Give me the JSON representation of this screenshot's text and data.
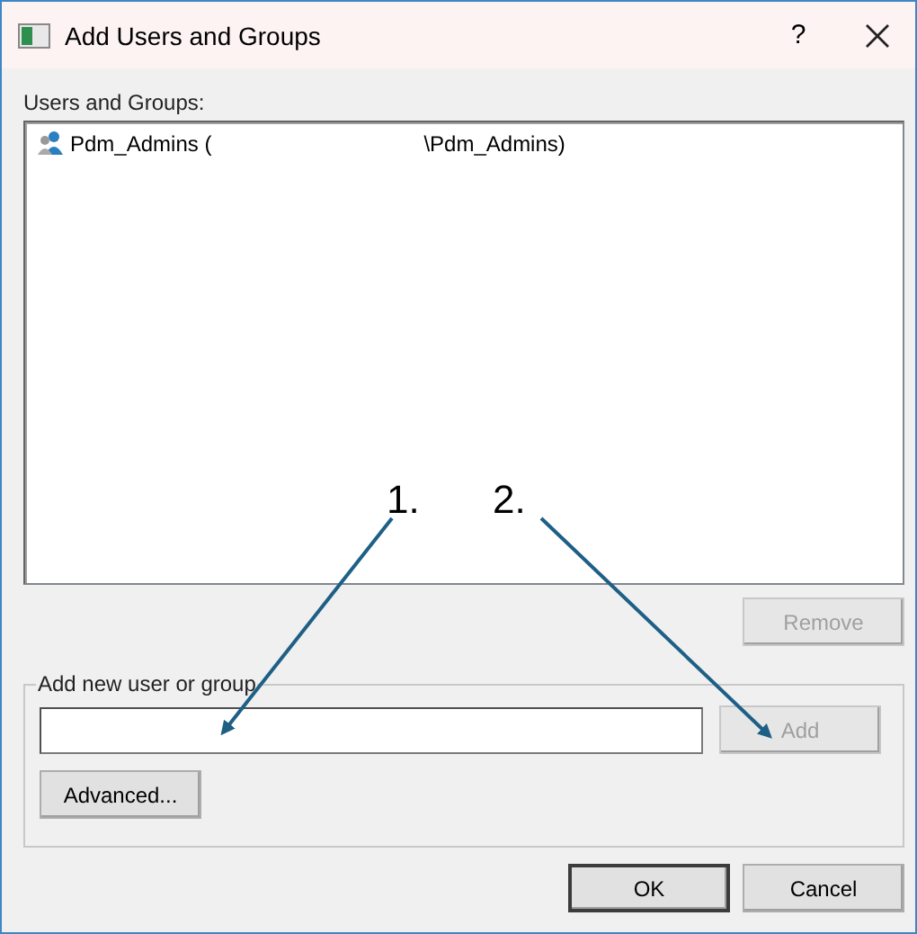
{
  "window": {
    "title": "Add Users and Groups",
    "help": "?"
  },
  "users_list": {
    "label": "Users and Groups:",
    "items": [
      {
        "text_before": "Pdm_Admins (",
        "text_after": "\\Pdm_Admins)",
        "selected": false
      }
    ]
  },
  "remove_button": {
    "label": "Remove",
    "disabled": true
  },
  "add_group": {
    "legend": "Add new user or group",
    "add_button": {
      "label": "Add",
      "disabled": true
    },
    "advanced_button": {
      "label": "Advanced...",
      "disabled": false
    }
  },
  "buttons": [
    {
      "label": "OK",
      "default": true
    },
    {
      "label": "Cancel",
      "default": false
    }
  ],
  "annotations": [
    {
      "label": "1."
    },
    {
      "label": "2."
    }
  ]
}
